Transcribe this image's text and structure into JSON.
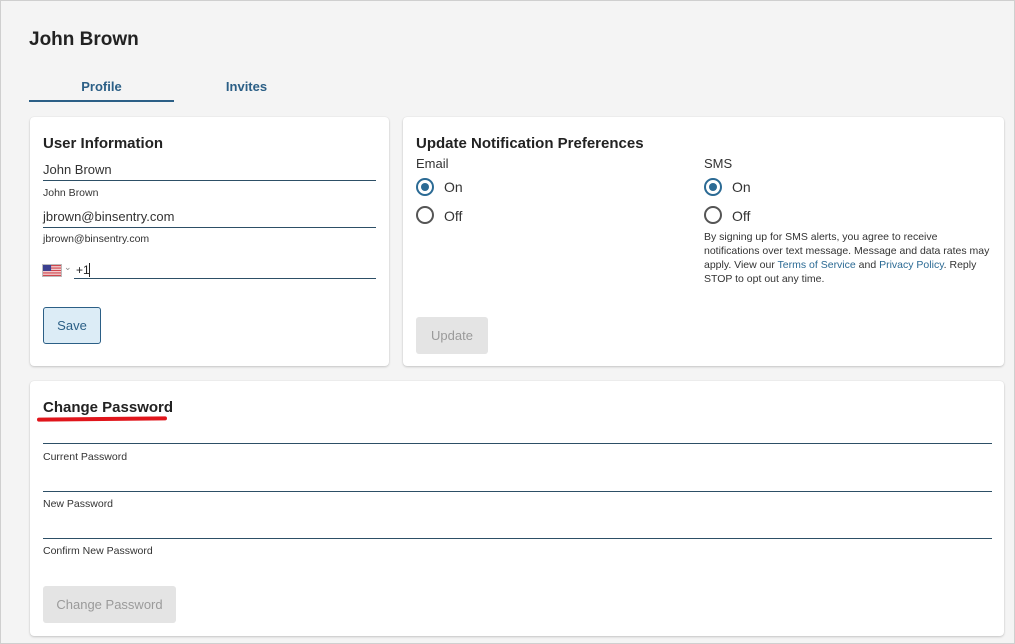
{
  "header": {
    "title": "John Brown"
  },
  "tabs": [
    {
      "label": "Profile",
      "active": true
    },
    {
      "label": "Invites",
      "active": false
    }
  ],
  "user_info": {
    "title": "User Information",
    "name_value": "John Brown",
    "name_caption": "John Brown",
    "email_value": "jbrown@binsentry.com",
    "email_caption": "jbrown@binsentry.com",
    "phone_country_icon": "us-flag-icon",
    "phone_value": "+1",
    "save_label": "Save"
  },
  "notifications": {
    "title": "Update Notification Preferences",
    "email": {
      "label": "Email",
      "on_label": "On",
      "off_label": "Off",
      "selected": "On"
    },
    "sms": {
      "label": "SMS",
      "on_label": "On",
      "off_label": "Off",
      "selected": "On"
    },
    "sms_note": {
      "part1": "By signing up for SMS alerts, you agree to receive notifications over text message. Message and data rates may apply. View our ",
      "terms_link": "Terms of Service",
      "and": " and ",
      "privacy_link": "Privacy Policy",
      "part2": ". Reply STOP to opt out any time."
    },
    "update_label": "Update"
  },
  "password": {
    "title": "Change Password",
    "current_caption": "Current Password",
    "new_caption": "New Password",
    "confirm_caption": "Confirm New Password",
    "change_label": "Change Password"
  },
  "colors": {
    "accent": "#2b5f86",
    "radio": "#2b6a94",
    "annotation_red": "#e0151b",
    "background": "#f4f4f4"
  }
}
